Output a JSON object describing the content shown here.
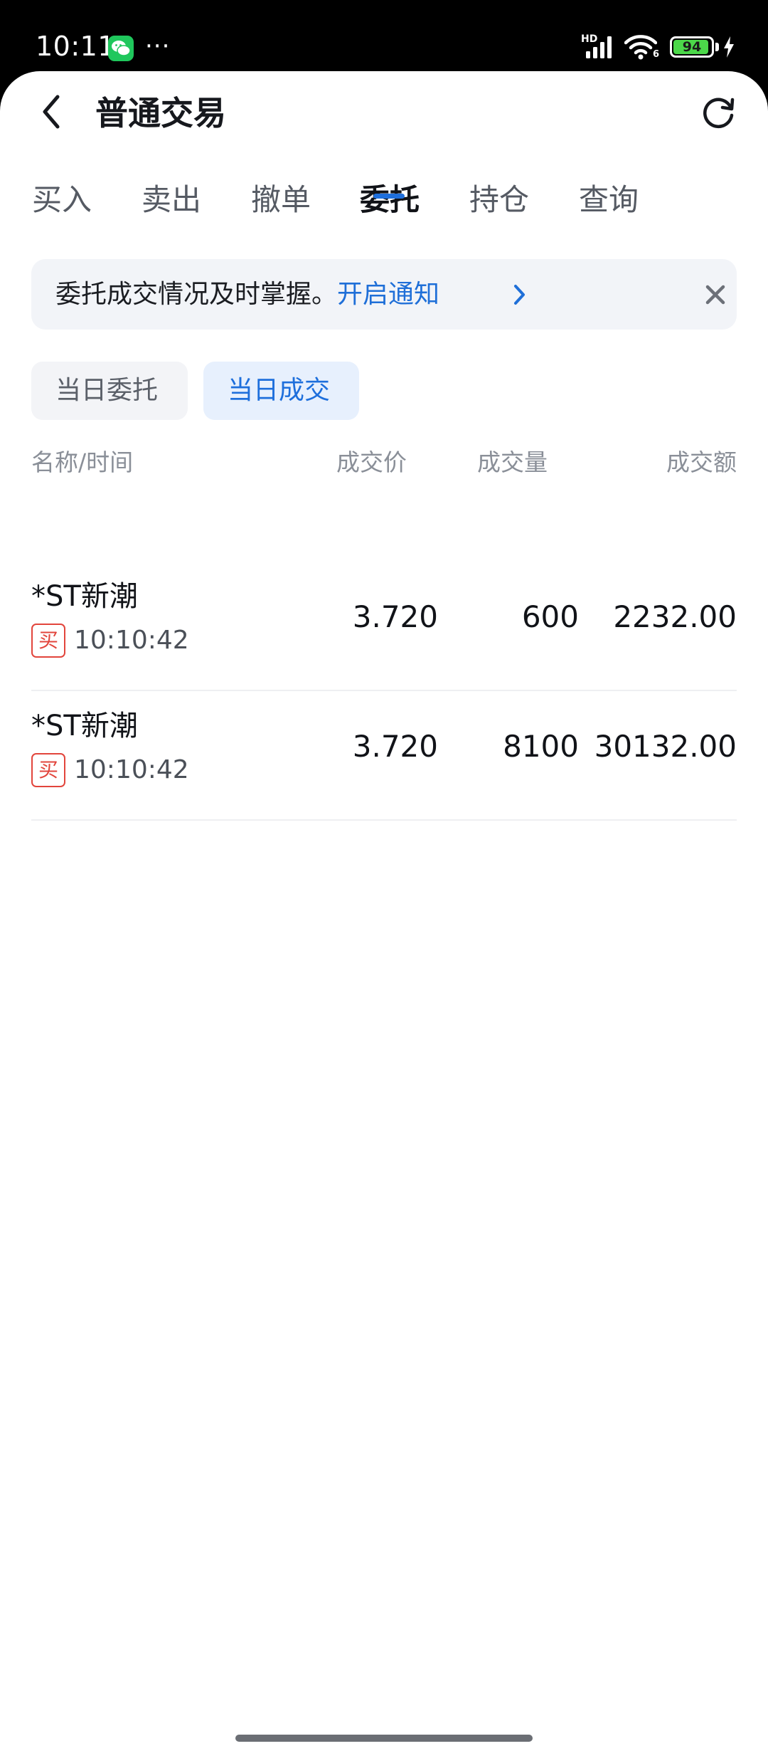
{
  "status_bar": {
    "time": "10:11",
    "more": "···",
    "network_label": "HD",
    "wifi_label": "6",
    "battery_level": 94,
    "battery_text": "94",
    "icons": [
      "wechat-icon",
      "signal-icon",
      "wifi-icon",
      "battery-icon",
      "charging-icon"
    ]
  },
  "header": {
    "title": "普通交易",
    "back_icon": "chevron-left-icon",
    "refresh_icon": "refresh-icon"
  },
  "tabs": [
    {
      "label": "买入",
      "active": false
    },
    {
      "label": "卖出",
      "active": false
    },
    {
      "label": "撤单",
      "active": false
    },
    {
      "label": "委托",
      "active": true
    },
    {
      "label": "持仓",
      "active": false
    },
    {
      "label": "查询",
      "active": false
    }
  ],
  "notice": {
    "text": "委托成交情况及时掌握。",
    "link": "开启通知",
    "accent_color": "#1f6fd8"
  },
  "filters": [
    {
      "label": "当日委托",
      "active": false
    },
    {
      "label": "当日成交",
      "active": true
    }
  ],
  "table": {
    "headers": {
      "name_time": "名称/时间",
      "price": "成交价",
      "volume": "成交量",
      "amount": "成交额"
    },
    "rows": [
      {
        "name": "*ST新潮",
        "side": "买",
        "time": "10:10:42",
        "price": "3.720",
        "volume": "600",
        "amount": "2232.00"
      },
      {
        "name": "*ST新潮",
        "side": "买",
        "time": "10:10:42",
        "price": "3.720",
        "volume": "8100",
        "amount": "30132.00"
      }
    ]
  },
  "colors": {
    "accent": "#1e6fdc",
    "buy": "#e2453c",
    "battery": "#4cd84a"
  }
}
